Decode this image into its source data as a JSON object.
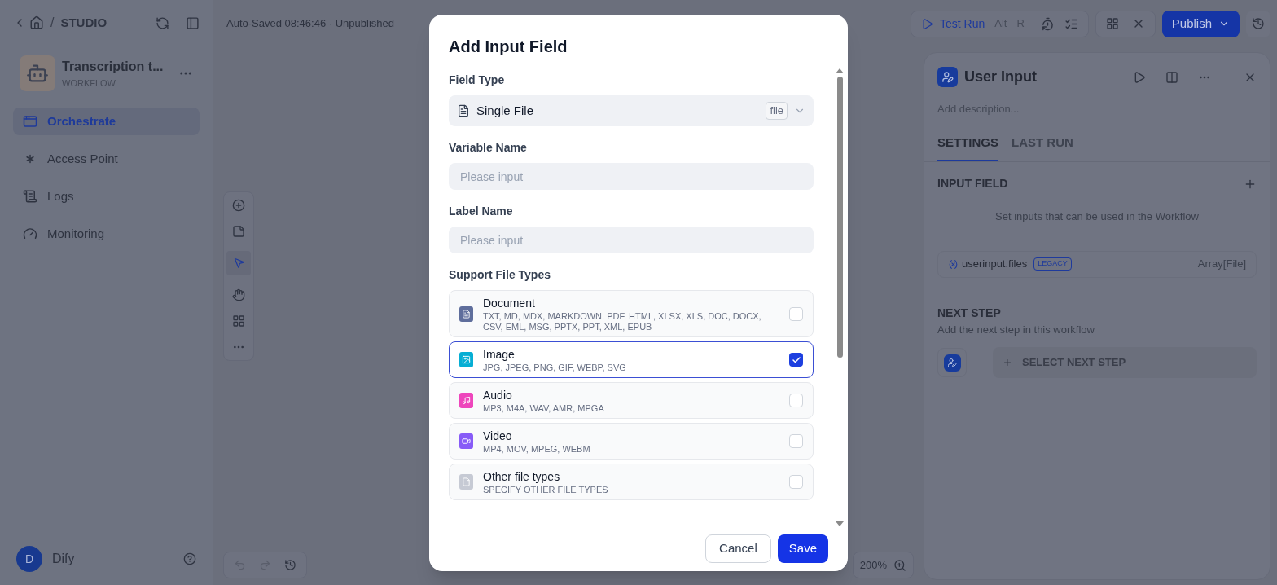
{
  "breadcrumb": {
    "separator": "/",
    "section": "STUDIO"
  },
  "app": {
    "name": "Transcription t...",
    "type": "WORKFLOW"
  },
  "nav": [
    {
      "kind": "orchestrate",
      "label": "Orchestrate",
      "selected": true
    },
    {
      "kind": "access",
      "label": "Access Point",
      "selected": false
    },
    {
      "kind": "logs",
      "label": "Logs",
      "selected": false
    },
    {
      "kind": "monitoring",
      "label": "Monitoring",
      "selected": false
    }
  ],
  "user": {
    "initial": "D",
    "name": "Dify"
  },
  "status": "Auto-Saved 08:46:46 · Unpublished",
  "toolbar": {
    "test_run": "Test Run",
    "shortcut": [
      "Alt",
      "R"
    ],
    "publish": "Publish"
  },
  "zoom": "200%",
  "panel": {
    "title": "User Input",
    "description_placeholder": "Add description...",
    "tabs": [
      {
        "label": "SETTINGS",
        "selected": true
      },
      {
        "label": "LAST RUN",
        "selected": false
      }
    ],
    "input_section": "INPUT FIELD",
    "empty_hint": "Set inputs that can be used in the Workflow",
    "variable": {
      "name": "userinput.files",
      "badge": "LEGACY",
      "type": "Array[File]"
    },
    "next_title": "NEXT STEP",
    "next_hint": "Add the next step in this workflow",
    "next_button": "SELECT NEXT STEP"
  },
  "dialog": {
    "title": "Add Input Field",
    "field_type": {
      "label": "Field Type",
      "value": "Single File",
      "tag": "file"
    },
    "variable_name": {
      "label": "Variable Name",
      "placeholder": "Please input"
    },
    "label_name": {
      "label": "Label Name",
      "placeholder": "Please input"
    },
    "file_types_label": "Support File Types",
    "file_types": [
      {
        "kind": "document",
        "name": "Document",
        "extensions": "TXT, MD, MDX, MARKDOWN, PDF, HTML, XLSX, XLS, DOC, DOCX, CSV, EML, MSG, PPTX, PPT, XML, EPUB",
        "checked": false
      },
      {
        "kind": "image",
        "name": "Image",
        "extensions": "JPG, JPEG, PNG, GIF, WEBP, SVG",
        "checked": true
      },
      {
        "kind": "audio",
        "name": "Audio",
        "extensions": "MP3, M4A, WAV, AMR, MPGA",
        "checked": false
      },
      {
        "kind": "video",
        "name": "Video",
        "extensions": "MP4, MOV, MPEG, WEBM",
        "checked": false
      },
      {
        "kind": "other",
        "name": "Other file types",
        "extensions": "SPECIFY OTHER FILE TYPES",
        "checked": false
      }
    ],
    "cancel": "Cancel",
    "save": "Save"
  }
}
